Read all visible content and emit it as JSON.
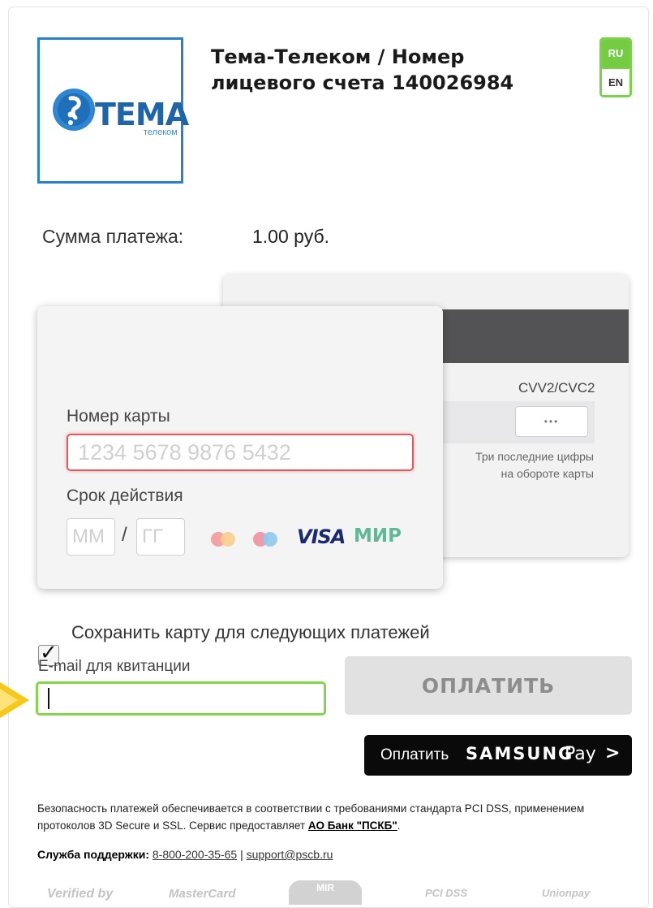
{
  "merchant": {
    "logo_text": "ТЕМА",
    "logo_subtext": "телеком",
    "title": "Тема-Телеком / Номер лицевого счета 140026984"
  },
  "language": {
    "ru": "RU",
    "en": "EN",
    "active": "RU"
  },
  "payment": {
    "amount_label": "Сумма платежа:",
    "amount_value": "1.00 руб."
  },
  "card_form": {
    "number_label": "Номер карты",
    "number_placeholder": "1234 5678 9876 5432",
    "expiry_label": "Срок действия",
    "month_placeholder": "ММ",
    "year_placeholder": "ГГ",
    "expiry_separator": "/",
    "brands": [
      "mastercard-icon",
      "maestro-icon",
      "VISA",
      "МИР"
    ],
    "cvv_label": "CVV2/CVC2",
    "cvv_placeholder": "•••",
    "cvv_hint": "Три последние цифры на обороте карты"
  },
  "options": {
    "save_card_label": "Сохранить карту для следующих платежей",
    "save_card_checked": true,
    "email_label": "E-mail для квитанции",
    "email_value": ""
  },
  "actions": {
    "pay_label": "ОПЛАТИТЬ",
    "samsung_prefix": "Оплатить",
    "samsung_brand": "SAMSUNG",
    "samsung_pay": "Pay",
    "samsung_chevron": ">"
  },
  "footer": {
    "security_text_1": "Безопасность платежей обеспечивается в соответствии с требованиями стандарта PCI DSS, применением протоколов 3D Secure и SSL. Сервис предоставляет ",
    "security_bank": "АО Банк \"ПСКБ\"",
    "security_text_end": ".",
    "support_label": "Служба поддержки:",
    "support_phone": "8-800-200-35-65",
    "support_separator": "|",
    "support_email": "support@pscb.ru",
    "trust_logos": [
      "Verified by",
      "MasterCard",
      "MIR",
      "PCI DSS",
      "Unionpay"
    ]
  },
  "colors": {
    "accent_green": "#7bd24a",
    "logo_blue": "#2a7fc8",
    "error_red": "#e05a5a",
    "pay_disabled_bg": "#e1e1e2"
  }
}
